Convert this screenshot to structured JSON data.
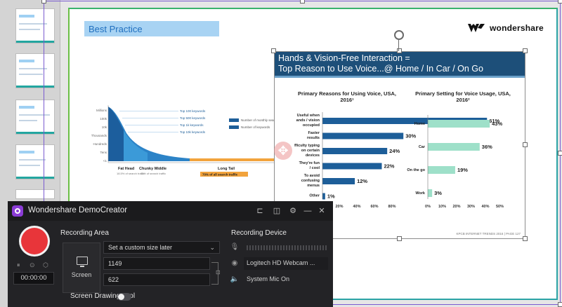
{
  "slide": {
    "best_practice": "Best Practice",
    "logo_text": "wondershare",
    "long_tail": {
      "y_labels": [
        "Millions",
        "100k",
        "10k",
        "Thousands",
        "Hundreds",
        "Tens",
        "<1"
      ],
      "keywords": [
        "Top 100 keywords",
        "Top 500 keywords",
        "Top 1k keywords",
        "Top 10k keywords"
      ],
      "legend": [
        "Number of monthly searches",
        "Number of keywords"
      ],
      "categories": [
        "Fat Head",
        "Chunky Middle",
        "Long Tail"
      ],
      "fat_head_note": "18.5% of search traffic",
      "chunky_note": "11% of search traffic",
      "long_tail_note": "70% of all search traffic"
    },
    "picture": {
      "header_line1": "Hands & Vision-Free Interaction =",
      "header_line2": "Top Reason to Use Voice...@ Home / In Car / On Go",
      "footer": "KPCB INTERNET TRENDS 2016 | PAGE 127"
    }
  },
  "chart_data": [
    {
      "type": "bar",
      "title": "Primary Reasons for Using Voice, USA, 2016¹",
      "categories": [
        "Useful when hands / vision occupied",
        "Faster results",
        "Difficulty typing on certain devices",
        "They're fun / cool",
        "To avoid confusing menus",
        "Other"
      ],
      "category_labels": [
        [
          "Useful when",
          "ands / vision",
          "occupied"
        ],
        [
          "Faster",
          "results"
        ],
        [
          "fficulty typing",
          "on certain",
          "devices"
        ],
        [
          "They're fun",
          "/ cool"
        ],
        [
          "To avoid",
          "confusing",
          "menus"
        ],
        [
          "Other"
        ]
      ],
      "values": [
        61,
        30,
        24,
        22,
        12,
        1
      ],
      "value_labels": [
        "61%",
        "30%",
        "24%",
        "22%",
        "12%",
        "1%"
      ],
      "xlim": [
        0,
        80
      ],
      "xticks": [
        "20%",
        "40%",
        "60%",
        "80%"
      ],
      "color": "#1d5e99"
    },
    {
      "type": "bar",
      "title": "Primary Setting for Voice Usage, USA, 2016²",
      "categories": [
        "Home",
        "Car",
        "On the go",
        "Work"
      ],
      "values": [
        43,
        36,
        19,
        3
      ],
      "value_labels": [
        "43%",
        "36%",
        "19%",
        "3%"
      ],
      "xlim": [
        0,
        50
      ],
      "xticks": [
        "0%",
        "10%",
        "20%",
        "30%",
        "40%",
        "50%"
      ],
      "color": "#9ee0c9"
    }
  ],
  "recorder": {
    "title": "Wondershare DemoCreator",
    "timer": "00:00:00",
    "recording_area_label": "Recording Area",
    "screen_label": "Screen",
    "size_option": "Set a custom size later",
    "width": "1149",
    "height": "622",
    "recording_device_label": "Recording Device",
    "webcam": "Logitech HD Webcam ...",
    "mic": "System Mic On",
    "drawing_tool_label": "Screen Drawing Tool"
  }
}
